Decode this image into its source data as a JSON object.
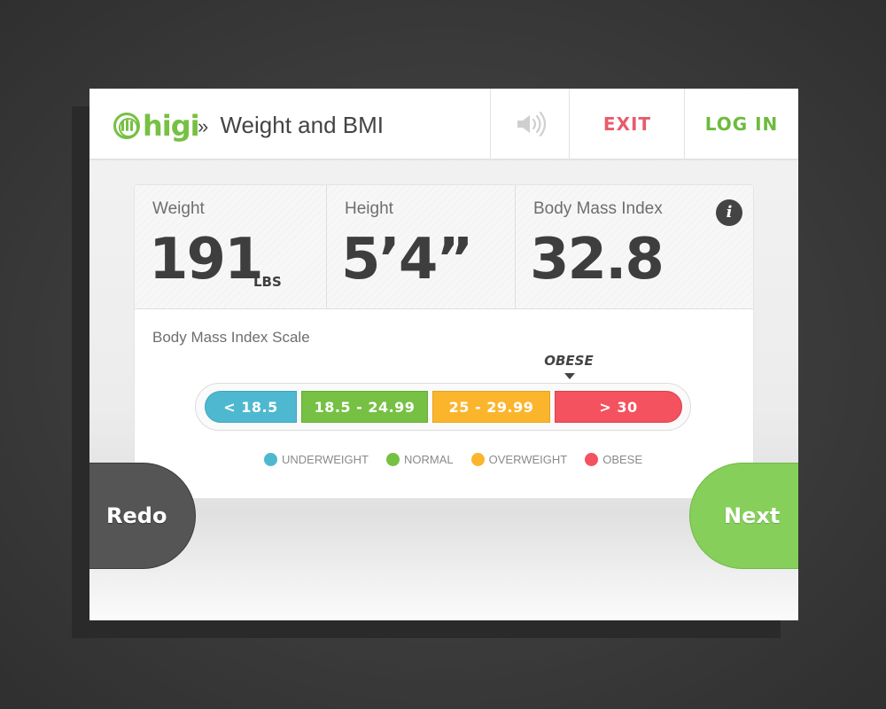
{
  "header": {
    "logo_text": "higi",
    "breadcrumb_separator": "»",
    "page_title": "Weight and BMI",
    "sound_icon": "speaker-volume-icon",
    "exit_label": "EXIT",
    "login_label": "LOG IN"
  },
  "stats": {
    "weight": {
      "label": "Weight",
      "value": "191",
      "unit": "LBS"
    },
    "height": {
      "label": "Height",
      "value": "5’4”"
    },
    "bmi": {
      "label": "Body Mass Index",
      "value": "32.8",
      "info_icon": "i"
    }
  },
  "scale": {
    "title": "Body Mass Index Scale",
    "current_category": "OBESE",
    "segments": [
      {
        "label": "< 18.5",
        "category": "UNDERWEIGHT",
        "color": "#4eb8d0"
      },
      {
        "label": "18.5 - 24.99",
        "category": "NORMAL",
        "color": "#76c043"
      },
      {
        "label": "25 - 29.99",
        "category": "OVERWEIGHT",
        "color": "#fbb52d"
      },
      {
        "label": "> 30",
        "category": "OBESE",
        "color": "#f4525e"
      }
    ]
  },
  "legend": [
    {
      "label": "UNDERWEIGHT",
      "color": "#4eb8d0"
    },
    {
      "label": "NORMAL",
      "color": "#76c043"
    },
    {
      "label": "OVERWEIGHT",
      "color": "#fbb52d"
    },
    {
      "label": "OBESE",
      "color": "#f4525e"
    }
  ],
  "actions": {
    "redo_label": "Redo",
    "next_label": "Next"
  },
  "colors": {
    "brand_green": "#76c043",
    "exit_red": "#e85c6a",
    "login_green": "#6dbb3e"
  }
}
